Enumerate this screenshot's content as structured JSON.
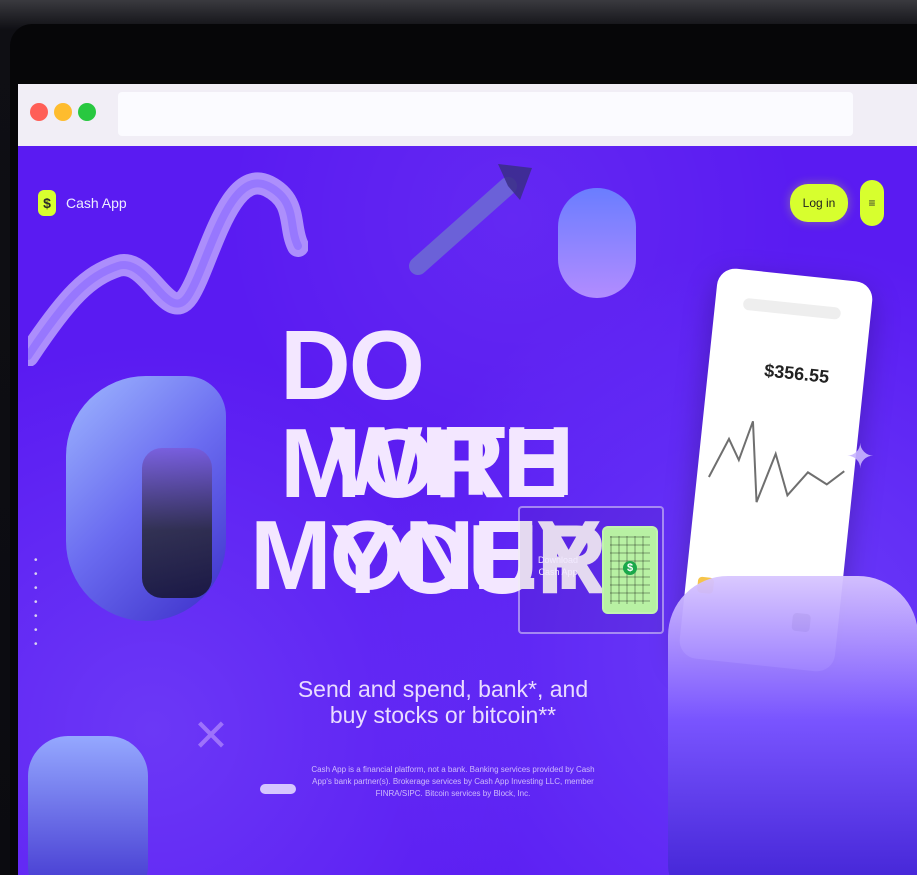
{
  "browser": {
    "traffic_lights": [
      {
        "name": "close",
        "color": "#ff5f57"
      },
      {
        "name": "minimize",
        "color": "#febc2e"
      },
      {
        "name": "zoom",
        "color": "#28c840"
      }
    ]
  },
  "site": {
    "brand": {
      "icon_text": "$",
      "label": "Cash App",
      "accent": "#D7FF2E"
    },
    "header": {
      "login_label": "Log in",
      "menu_icon": "menu-icon"
    },
    "hero": {
      "headline": [
        "DO MORE",
        "WITH YOUR",
        "MONEY"
      ],
      "qr": {
        "label": "Download Cash App",
        "icon_name": "qr-code-icon"
      },
      "subheadline": "Send and spend, bank*, and buy stocks or bitcoin**",
      "fine_print": "Cash App is a financial platform, not a bank. Banking services provided by Cash App's bank partner(s). Brokerage services by Cash App Investing LLC, member FINRA/SIPC. Bitcoin services by Block, Inc."
    },
    "phone": {
      "balance": "$356.55"
    },
    "colors": {
      "page_background": "#5A1BF2",
      "accent": "#D7FF2E",
      "headline": "#F3E7FF"
    }
  }
}
